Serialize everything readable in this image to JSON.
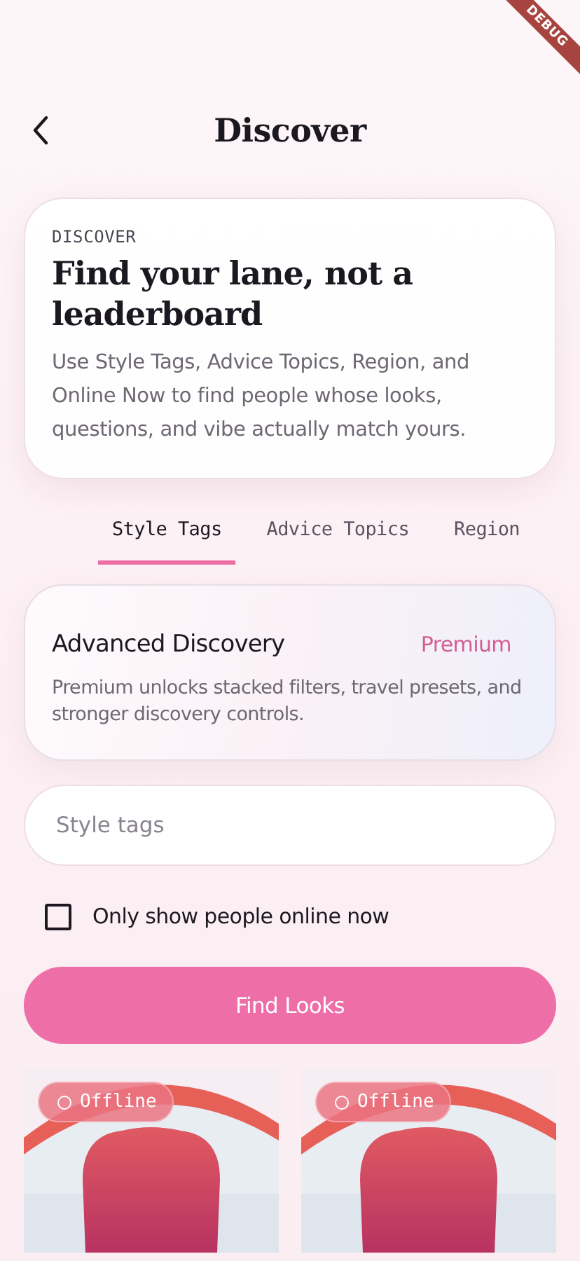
{
  "debug_banner": "DEBUG",
  "header": {
    "title": "Discover"
  },
  "hero": {
    "eyebrow": "DISCOVER",
    "title": "Find your lane, not a leaderboard",
    "body": "Use Style Tags, Advice Topics, Region, and Online Now to find people whose looks, questions, and vibe actually match yours."
  },
  "tabs": [
    {
      "label": "Style Tags",
      "selected": true
    },
    {
      "label": "Advice Topics",
      "selected": false
    },
    {
      "label": "Region",
      "selected": false
    }
  ],
  "premium_card": {
    "title": "Advanced Discovery",
    "badge": "Premium",
    "body": "Premium unlocks stacked filters, travel presets, and stronger discovery controls."
  },
  "search": {
    "placeholder": "Style tags"
  },
  "online_filter": {
    "label": "Only show people online now",
    "checked": false
  },
  "button": "Find Looks",
  "results": [
    {
      "status": "Offline",
      "online": false
    },
    {
      "status": "Offline",
      "online": false
    }
  ]
}
